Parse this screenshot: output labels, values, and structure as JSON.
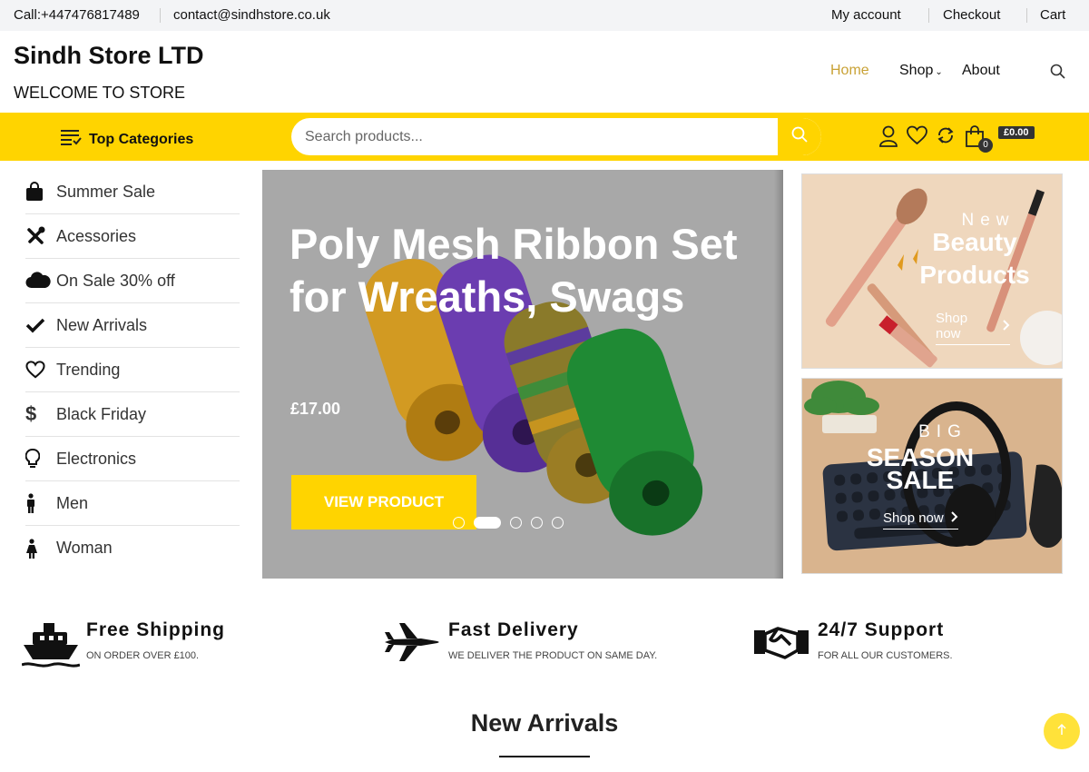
{
  "topbar": {
    "phone": "Call:+447476817489",
    "email": "contact@sindhstore.co.uk",
    "links": [
      "My account",
      "Checkout",
      "Cart"
    ]
  },
  "header": {
    "brand": "Sindh Store LTD",
    "tagline": "WELCOME TO STORE",
    "nav": [
      "Home",
      "Shop",
      "About"
    ],
    "active_nav": "Home"
  },
  "toolbar": {
    "top_categories": "Top Categories",
    "search_placeholder": "Search products...",
    "cart_count": "0",
    "cart_total": "£0.00"
  },
  "sidebar": {
    "items": [
      {
        "label": "Summer Sale",
        "icon": "shopping-bag-icon"
      },
      {
        "label": "Acessories",
        "icon": "tools-icon"
      },
      {
        "label": "On Sale 30% off",
        "icon": "cloud-icon"
      },
      {
        "label": "New Arrivals",
        "icon": "check-icon"
      },
      {
        "label": "Trending",
        "icon": "heart-icon"
      },
      {
        "label": "Black Friday",
        "icon": "dollar-icon"
      },
      {
        "label": "Electronics",
        "icon": "lightbulb-icon"
      },
      {
        "label": "Men",
        "icon": "male-icon"
      },
      {
        "label": "Woman",
        "icon": "female-icon"
      }
    ]
  },
  "slider": {
    "title": "Poly Mesh Ribbon Set for Wreaths, Swags",
    "price": "£17.00",
    "button": "VIEW PRODUCT",
    "active_dot": 1,
    "dot_count": 5
  },
  "banners": [
    {
      "small": "New",
      "big1": "Beauty",
      "big2": "Products",
      "link": "Shop now"
    },
    {
      "small": "BIG",
      "big1": "SEASON",
      "big2": "SALE",
      "link": "Shop now"
    }
  ],
  "features": [
    {
      "title": "Free Shipping",
      "sub": "ON ORDER OVER £100.",
      "icon": "ship-icon"
    },
    {
      "title": "Fast Delivery",
      "sub": "WE DELIVER THE PRODUCT ON SAME DAY.",
      "icon": "jet-icon"
    },
    {
      "title": "24/7 Support",
      "sub": "FOR ALL OUR CUSTOMERS.",
      "icon": "handshake-icon"
    }
  ],
  "section": {
    "title": "New Arrivals"
  },
  "colors": {
    "accent": "#ffd400",
    "nav_active": "#c9a236",
    "dark": "#111111"
  }
}
